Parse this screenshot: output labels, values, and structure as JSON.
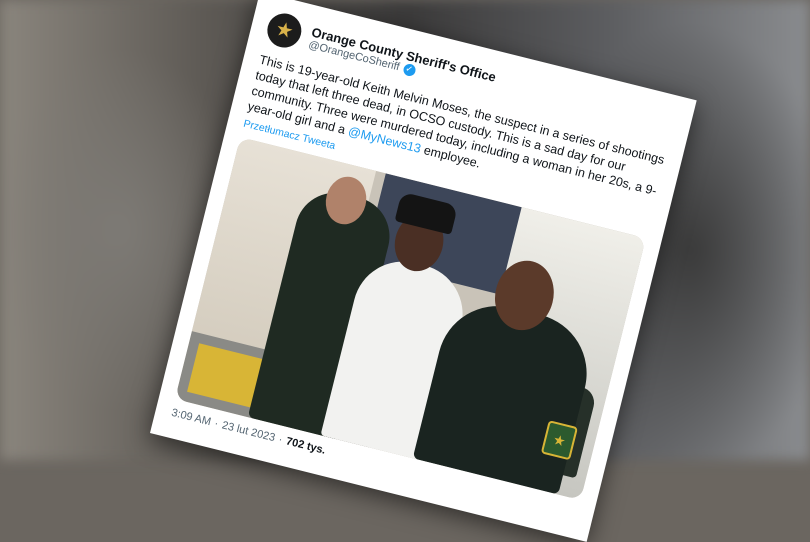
{
  "tweet": {
    "display_name": "Orange County Sheriff's Office",
    "handle": "@OrangeCoSheriff",
    "text_before_mention": "This is 19-year-old Keith Melvin Moses, the suspect in a series of shootings today that left three dead, in OCSO custody. This is a sad day for our community. Three were murdered today, including a woman in her 20s, a 9-year-old girl and a ",
    "mention": "@MyNews13",
    "text_after_mention": " employee.",
    "translate_label": "Przetłumacz Tweeta",
    "time": "3:09 AM",
    "separator": "·",
    "date": "23 lut 2023",
    "views": "702 tys."
  },
  "icons": {
    "avatar": "sheriff-star-icon",
    "verified": "verified-badge-icon"
  },
  "colors": {
    "link": "#1d9bf0",
    "text": "#0f1419",
    "muted": "#536471"
  }
}
